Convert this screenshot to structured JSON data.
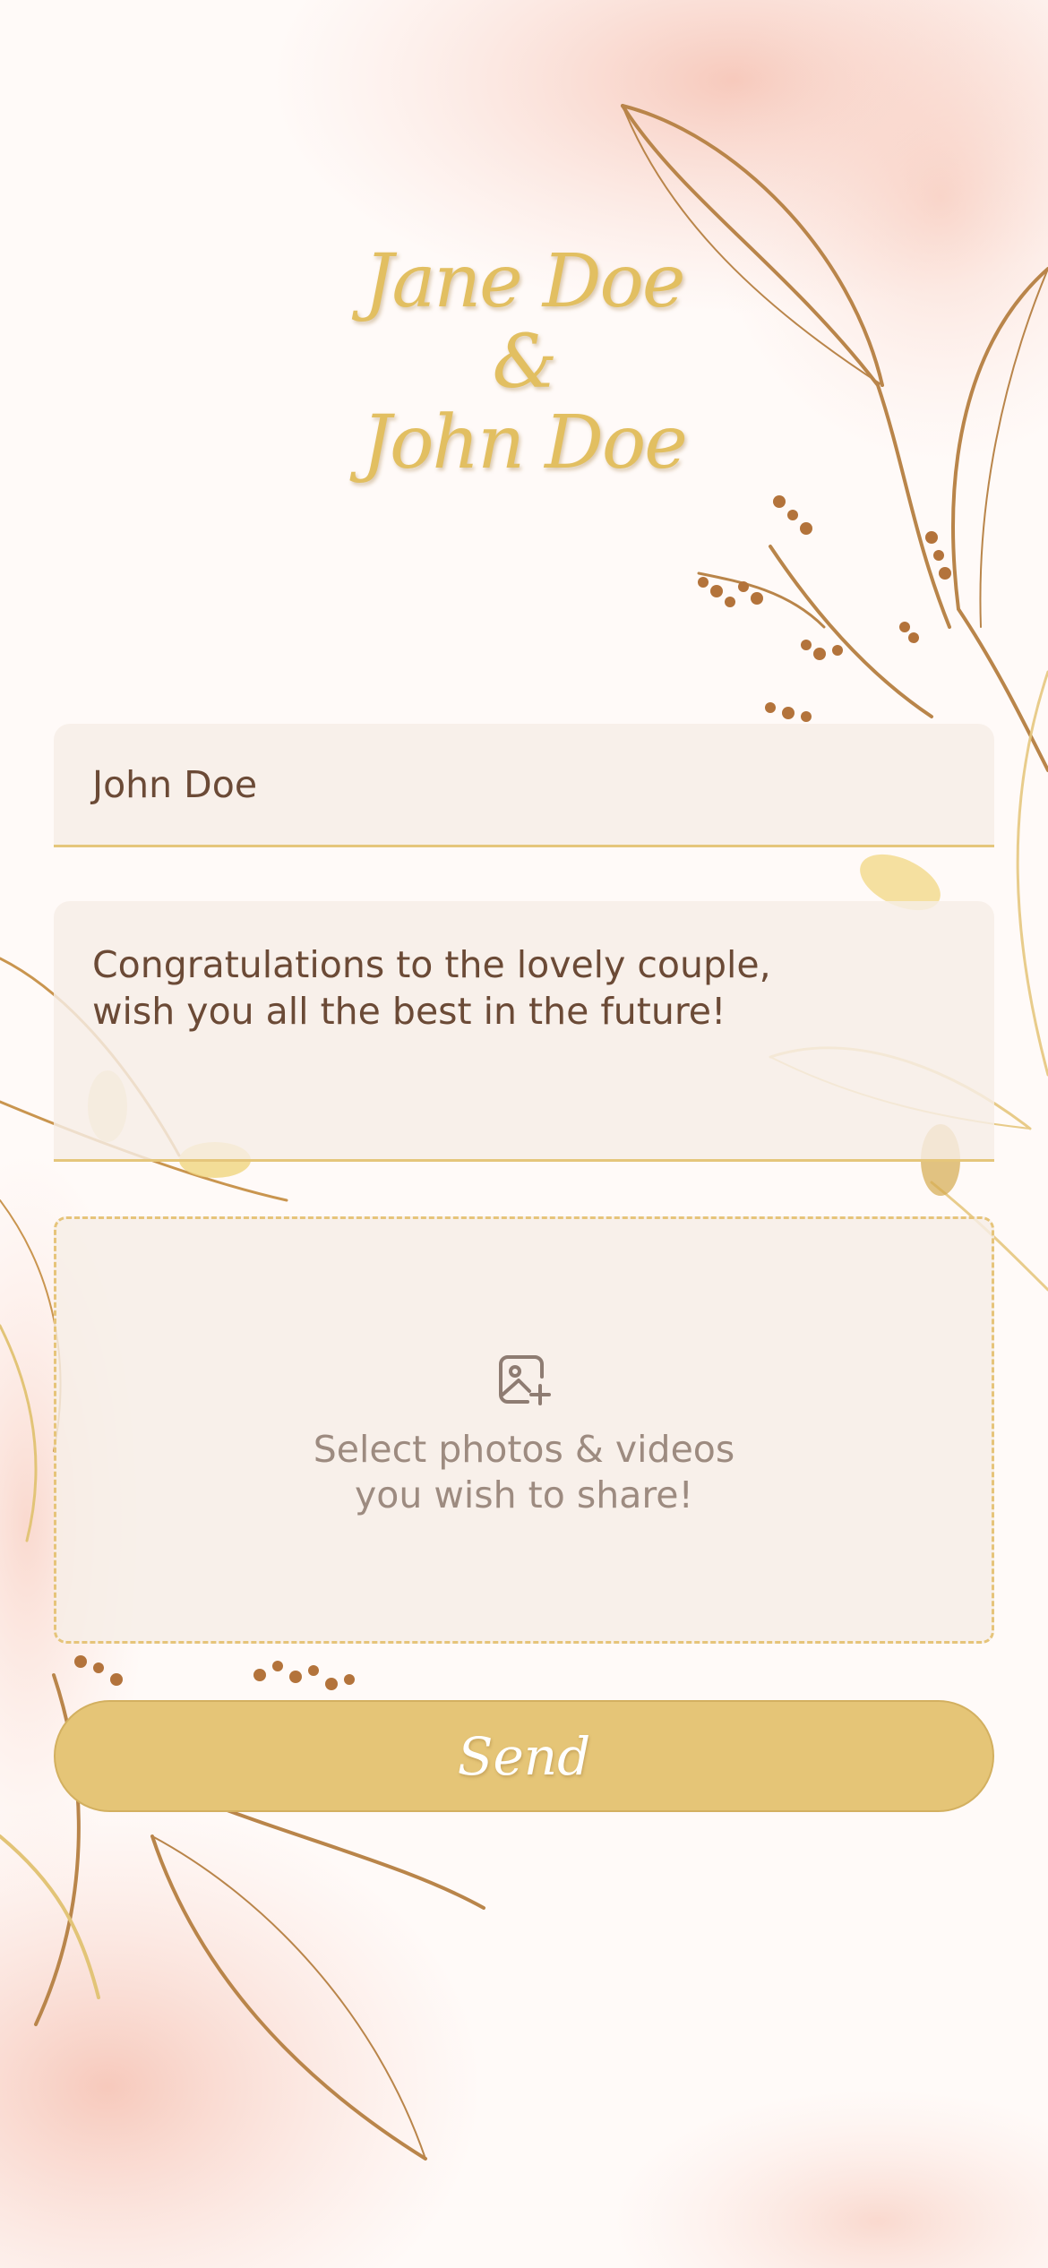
{
  "header": {
    "bride": "Jane Doe",
    "ampersand": "&",
    "groom": "John Doe"
  },
  "form": {
    "name_value": "John Doe",
    "message_value": "Congratulations to the lovely couple,\nwish you all the best in the future!",
    "upload_label_line1": "Select photos & videos",
    "upload_label_line2": "you wish to share!",
    "upload_icon": "add-image-icon",
    "send_label": "Send"
  },
  "colors": {
    "gold": "#e2bf61",
    "button": "#e5c577",
    "field_bg": "#f6eee6",
    "text": "#6b4a36",
    "muted": "#9d8b80",
    "blush": "#f6c9bd"
  }
}
